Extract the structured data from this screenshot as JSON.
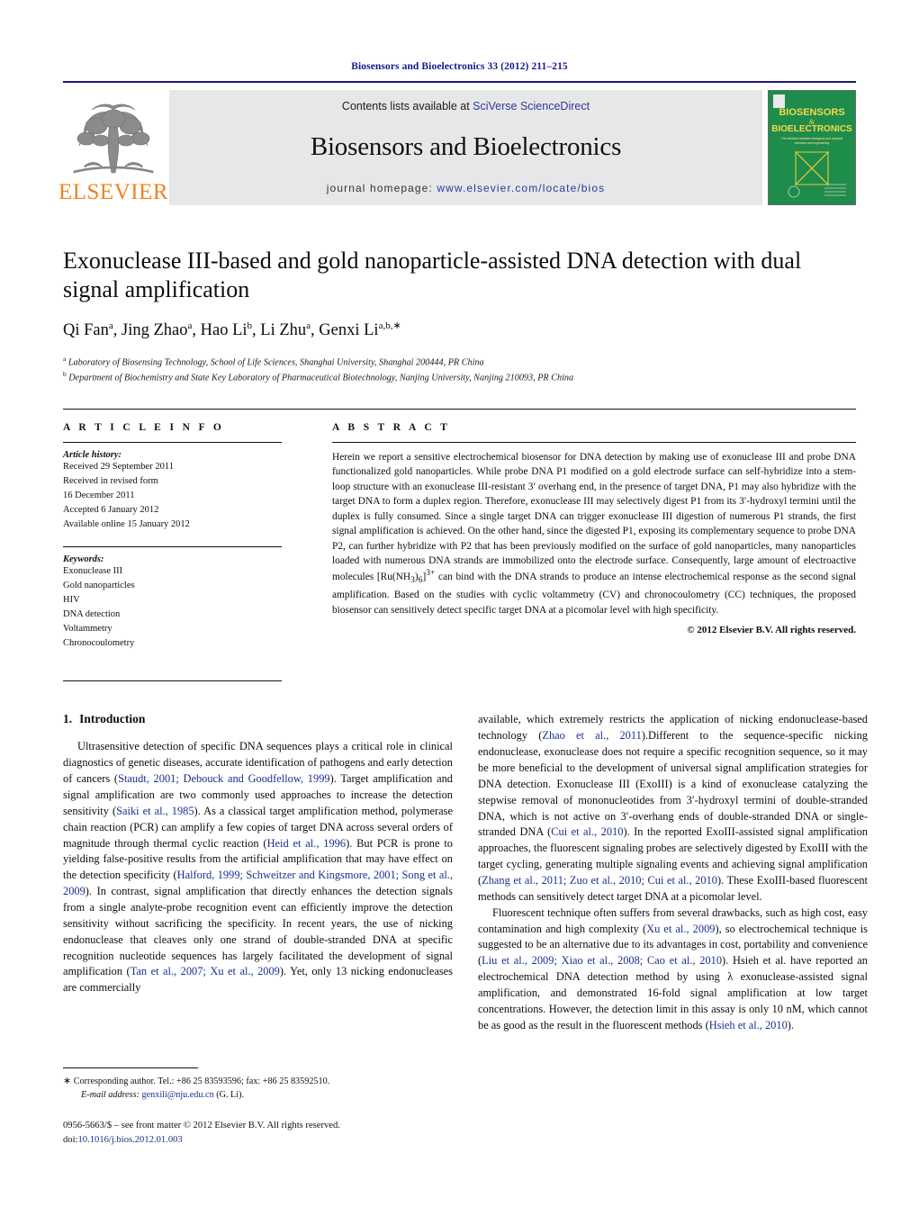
{
  "running_head": "Biosensors and Bioelectronics 33 (2012) 211–215",
  "masthead": {
    "publisher_name": "ELSEVIER",
    "contents_prefix": "Contents lists available at ",
    "contents_link": "SciVerse ScienceDirect",
    "journal_title": "Biosensors and Bioelectronics",
    "homepage_label": "journal homepage: ",
    "homepage_url": "www.elsevier.com/locate/bios",
    "cover": {
      "line1": "BIOSENSORS",
      "amp": "&",
      "line2": "BIOELECTRONICS",
      "subtitle": "The inferface between biological and physical sciences and engineering"
    }
  },
  "article": {
    "title": "Exonuclease III-based and gold nanoparticle-assisted DNA detection with dual signal amplification",
    "authors_html": "Qi Fan<sup>a</sup>, Jing Zhao<sup>a</sup>, Hao Li<sup>b</sup>, Li Zhu<sup>a</sup>, Genxi Li<sup>a,b,</sup><sup>∗</sup>",
    "affiliation_a": "Laboratory of Biosensing Technology, School of Life Sciences, Shanghai University, Shanghai 200444, PR China",
    "affiliation_b": "Department of Biochemistry and State Key Laboratory of Pharmaceutical Biotechnology, Nanjing University, Nanjing 210093, PR China"
  },
  "article_info": {
    "heading": "A R T I C L E   I N F O",
    "history_label": "Article history:",
    "history": [
      "Received 29 September 2011",
      "Received in revised form",
      "16 December 2011",
      "Accepted 6 January 2012",
      "Available online 15 January 2012"
    ],
    "keywords_label": "Keywords:",
    "keywords": [
      "Exonuclease III",
      "Gold nanoparticles",
      "HIV",
      "DNA detection",
      "Voltammetry",
      "Chronocoulometry"
    ]
  },
  "abstract": {
    "heading": "A B S T R A C T",
    "text": "Herein we report a sensitive electrochemical biosensor for DNA detection by making use of exonuclease III and probe DNA functionalized gold nanoparticles. While probe DNA P1 modified on a gold electrode surface can self-hybridize into a stem-loop structure with an exonuclease III-resistant 3′ overhang end, in the presence of target DNA, P1 may also hybridize with the target DNA to form a duplex region. Therefore, exonuclease III may selectively digest P1 from its 3′-hydroxyl termini until the duplex is fully consumed. Since a single target DNA can trigger exonuclease III digestion of numerous P1 strands, the first signal amplification is achieved. On the other hand, since the digested P1, exposing its complementary sequence to probe DNA P2, can further hybridize with P2 that has been previously modified on the surface of gold nanoparticles, many nanoparticles loaded with numerous DNA strands are immobilized onto the electrode surface. Consequently, large amount of electroactive molecules [Ru(NH3)6]3+ can bind with the DNA strands to produce an intense electrochemical response as the second signal amplification. Based on the studies with cyclic voltammetry (CV) and chronocoulometry (CC) techniques, the proposed biosensor can sensitively detect specific target DNA at a picomolar level with high specificity.",
    "copyright": "© 2012 Elsevier B.V. All rights reserved."
  },
  "introduction": {
    "number": "1.",
    "heading": "Introduction",
    "left_paragraph": "Ultrasensitive detection of specific DNA sequences plays a critical role in clinical diagnostics of genetic diseases, accurate identification of pathogens and early detection of cancers (Staudt, 2001; Debouck and Goodfellow, 1999). Target amplification and signal amplification are two commonly used approaches to increase the detection sensitivity (Saiki et al., 1985). As a classical target amplification method, polymerase chain reaction (PCR) can amplify a few copies of target DNA across several orders of magnitude through thermal cyclic reaction (Heid et al., 1996). But PCR is prone to yielding false-positive results from the artificial amplification that may have effect on the detection specificity (Halford, 1999; Schweitzer and Kingsmore, 2001; Song et al., 2009). In contrast, signal amplification that directly enhances the detection signals from a single analyte-probe recognition event can efficiently improve the detection sensitivity without sacrificing the specificity. In recent years, the use of nicking endonuclease that cleaves only one strand of double-stranded DNA at specific recognition nucleotide sequences has largely facilitated the development of signal amplification (Tan et al., 2007; Xu et al., 2009). Yet, only 13 nicking endonucleases are commercially",
    "right_paragraph_1": "available, which extremely restricts the application of nicking endonuclease-based technology (Zhao et al., 2011).Different to the sequence-specific nicking endonuclease, exonuclease does not require a specific recognition sequence, so it may be more beneficial to the development of universal signal amplification strategies for DNA detection. Exonuclease III (ExoIII) is a kind of exonuclease catalyzing the stepwise removal of mononucleotides from 3′-hydroxyl termini of double-stranded DNA, which is not active on 3′-overhang ends of double-stranded DNA or single-stranded DNA (Cui et al., 2010). In the reported ExoIII-assisted signal amplification approaches, the fluorescent signaling probes are selectively digested by ExoIII with the target cycling, generating multiple signaling events and achieving signal amplification (Zhang et al., 2011; Zuo et al., 2010; Cui et al., 2010). These ExoIII-based fluorescent methods can sensitively detect target DNA at a picomolar level.",
    "right_paragraph_2": "Fluorescent technique often suffers from several drawbacks, such as high cost, easy contamination and high complexity (Xu et al., 2009), so electrochemical technique is suggested to be an alternative due to its advantages in cost, portability and convenience (Liu et al., 2009; Xiao et al., 2008; Cao et al., 2010). Hsieh et al. have reported an electrochemical DNA detection method by using λ exonuclease-assisted signal amplification, and demonstrated 16-fold signal amplification at low target concentrations. However, the detection limit in this assay is only 10 nM, which cannot be as good as the result in the fluorescent methods (Hsieh et al., 2010)."
  },
  "footnote": {
    "star": "∗",
    "corresponding": "Corresponding author. Tel.: +86 25 83593596; fax: +86 25 83592510.",
    "email_label": "E-mail address:",
    "email": "genxili@nju.edu.cn",
    "email_suffix": "(G. Li)."
  },
  "imprint": {
    "line1": "0956-5663/$ – see front matter © 2012 Elsevier B.V. All rights reserved.",
    "doi_label": "doi:",
    "doi": "10.1016/j.bios.2012.01.003"
  },
  "colors": {
    "accent_blue": "#1b2f8f",
    "link_blue": "#2b3a9c",
    "elsevier_orange": "#ee8420",
    "cover_green": "#1e8c4a",
    "band_gray": "#e6e7e8"
  }
}
